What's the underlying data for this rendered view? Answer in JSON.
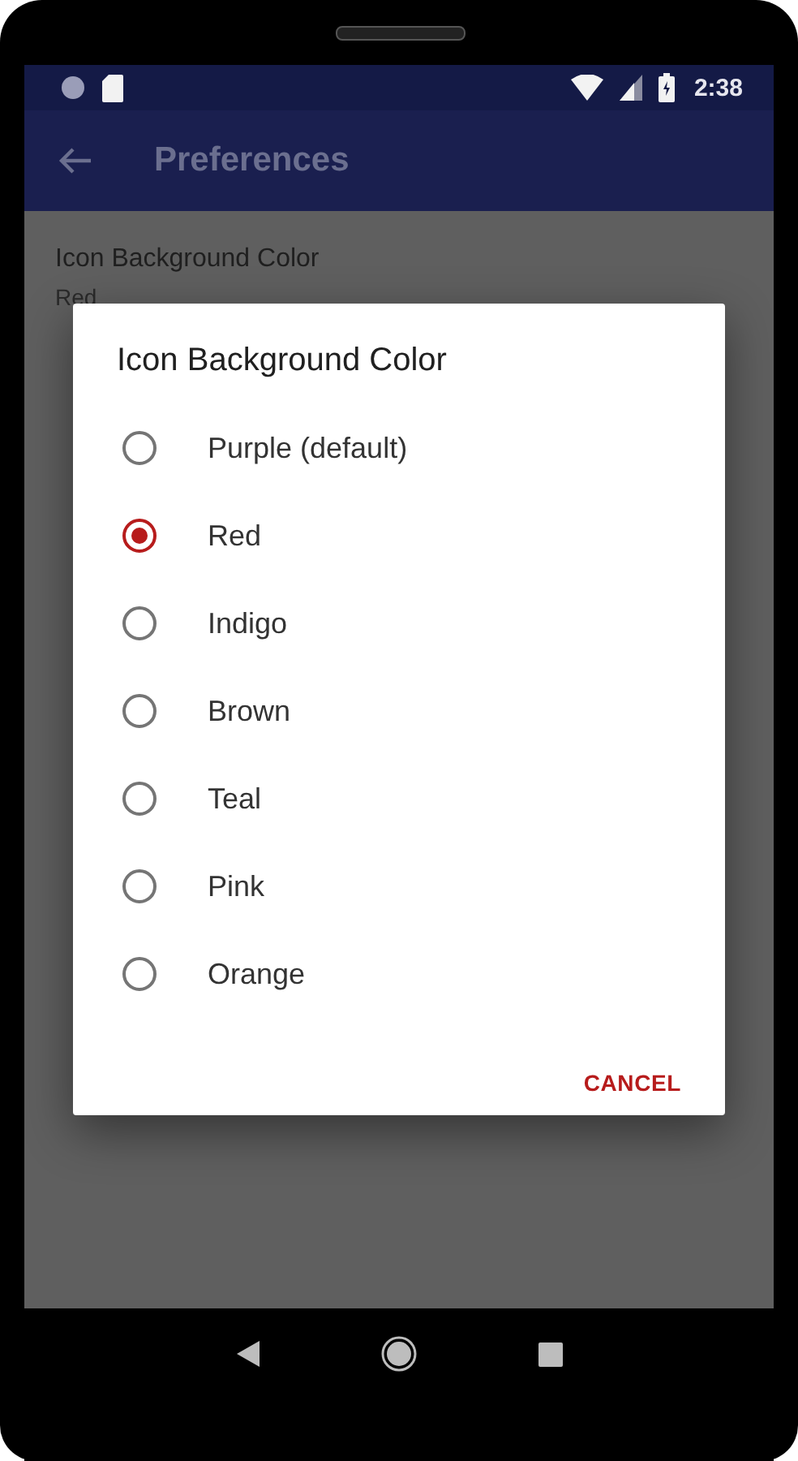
{
  "status_bar": {
    "time": "2:38"
  },
  "app_bar": {
    "title": "Preferences"
  },
  "preference": {
    "title": "Icon Background Color",
    "summary": "Red"
  },
  "dialog": {
    "title": "Icon Background Color",
    "options": [
      {
        "label": "Purple (default)",
        "selected": false
      },
      {
        "label": "Red",
        "selected": true
      },
      {
        "label": "Indigo",
        "selected": false
      },
      {
        "label": "Brown",
        "selected": false
      },
      {
        "label": "Teal",
        "selected": false
      },
      {
        "label": "Pink",
        "selected": false
      },
      {
        "label": "Orange",
        "selected": false
      }
    ],
    "buttons": [
      "CANCEL"
    ]
  }
}
